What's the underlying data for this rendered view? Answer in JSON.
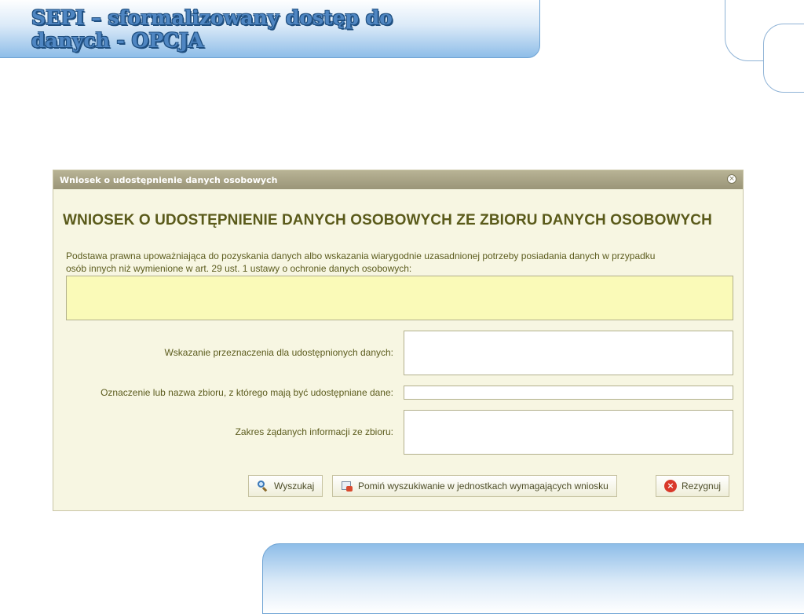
{
  "slide": {
    "title_line1": "SEPI – sformalizowany dostęp do",
    "title_line2": "danych - OPCJA"
  },
  "dialog": {
    "titlebar": "Wniosek o udostępnienie danych osobowych",
    "close_icon": "close-icon",
    "heading": "WNIOSEK O UDOSTĘPNIENIE DANYCH OSOBOWYCH ZE ZBIORU DANYCH OSOBOWYCH",
    "basis": {
      "label_line1": "Podstawa prawna upoważniająca do pozyskania danych albo wskazania wiarygodnie uzasadnionej potrzeby posiadania danych w przypadku",
      "label_line2": "osób innych niż wymienione w art. 29 ust. 1 ustawy o ochronie danych osobowych:",
      "value": ""
    },
    "fields": [
      {
        "label": "Wskazanie przeznaczenia dla udostępnionych danych:",
        "value": ""
      },
      {
        "label": "Oznaczenie lub nazwa zbioru, z którego mają być udostępniane dane:",
        "value": ""
      },
      {
        "label": "Zakres żądanych informacji ze zbioru:",
        "value": ""
      }
    ],
    "buttons": {
      "search": {
        "label": "Wyszukaj",
        "icon": "magnifier-icon"
      },
      "skip": {
        "label": "Pomiń wyszukiwanie w jednostkach wymagających wniosku",
        "icon": "document-skip-icon"
      },
      "cancel": {
        "label": "Rezygnuj",
        "icon": "cancel-icon"
      }
    }
  },
  "colors": {
    "title_blue": "#4f86c2",
    "dialog_bg": "#f7f6e2",
    "heading_olive": "#5a5a1a",
    "highlight_yellow": "#fafab8"
  }
}
